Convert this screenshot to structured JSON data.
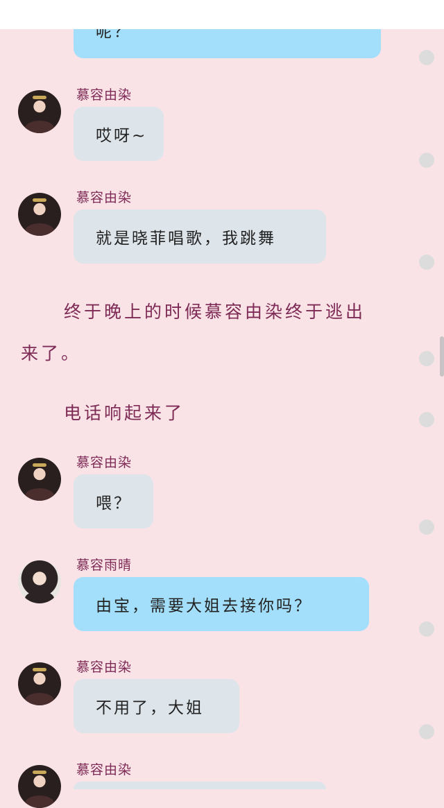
{
  "chat": {
    "partial_top_text": "呢？",
    "messages": [
      {
        "name": "慕容由染",
        "text": "哎呀~"
      },
      {
        "name": "慕容由染",
        "text": "就是晓菲唱歌，我跳舞"
      },
      {
        "name": "慕容由染",
        "text": "喂？"
      },
      {
        "name": "慕容雨晴",
        "text": "由宝，需要大姐去接你吗？"
      },
      {
        "name": "慕容由染",
        "text": "不用了，大姐"
      },
      {
        "name": "慕容由染",
        "text": ""
      }
    ],
    "narration": {
      "line1": "终于晚上的时候慕容由染终于逃出",
      "line2": "来了。",
      "line3": "电话响起来了"
    }
  }
}
